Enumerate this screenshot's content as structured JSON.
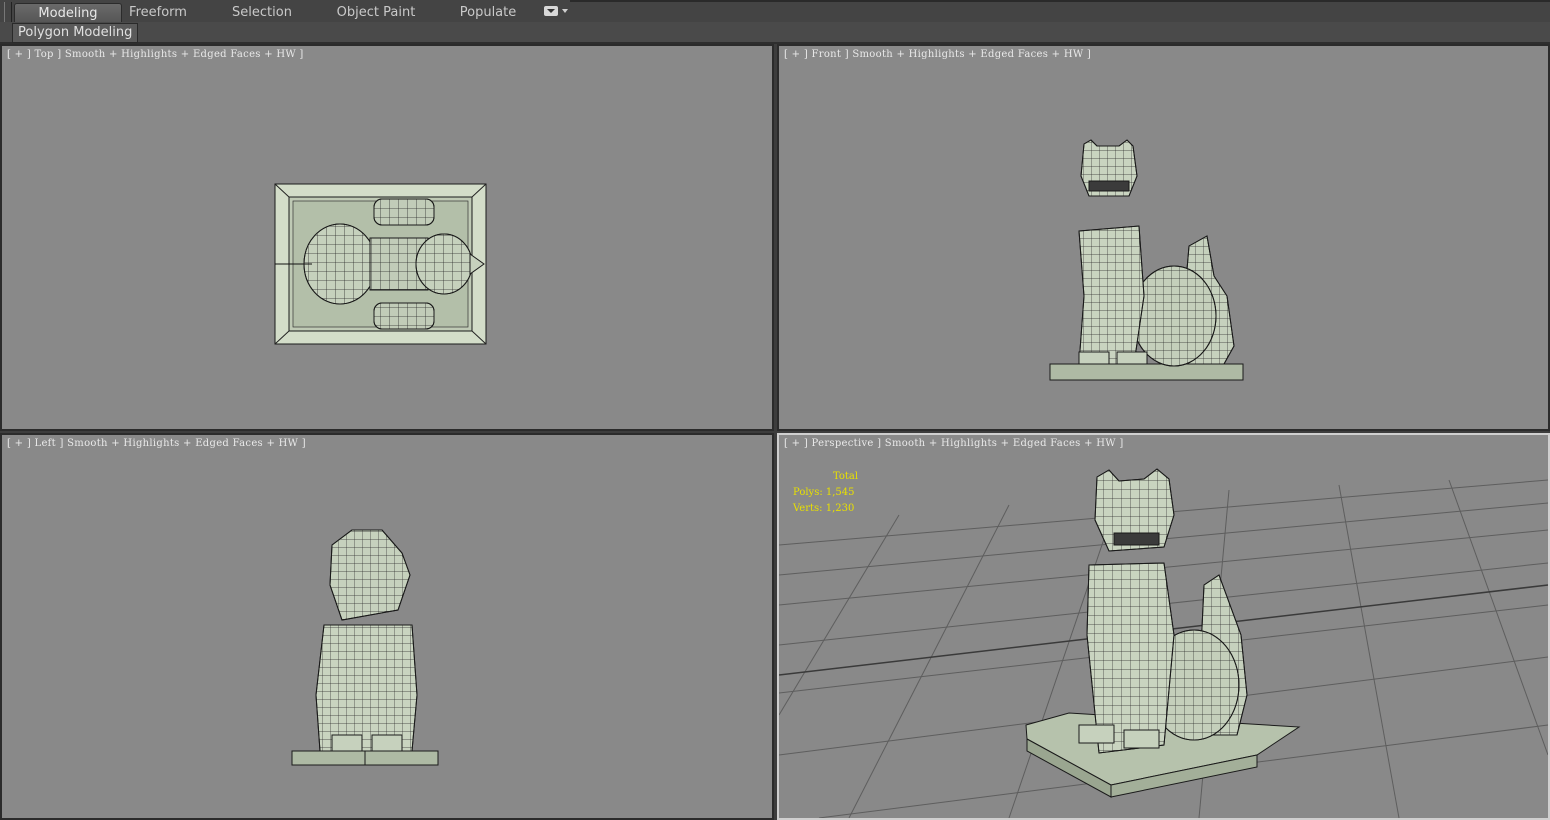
{
  "ribbon": {
    "tabs": [
      {
        "label": "Modeling",
        "active": true
      },
      {
        "label": "Freeform",
        "active": false
      },
      {
        "label": "Selection",
        "active": false
      },
      {
        "label": "Object Paint",
        "active": false
      },
      {
        "label": "Populate",
        "active": false
      }
    ],
    "panel_button": "Polygon Modeling"
  },
  "viewports": {
    "top": {
      "label": "[ + ] Top ] Smooth + Highlights + Edged Faces + HW ]"
    },
    "front": {
      "label": "[ + ] Front ] Smooth + Highlights + Edged Faces + HW ]"
    },
    "left": {
      "label": "[ + ] Left ] Smooth + Highlights + Edged Faces + HW ]"
    },
    "perspective": {
      "label": "[ + ] Perspective ] Smooth + Highlights + Edged Faces + HW ]",
      "stats": {
        "total": "Total",
        "polys": "Polys: 1,545",
        "verts": "Verts: 1,230"
      }
    }
  },
  "colors": {
    "viewport_bg": "#898989",
    "model_fill": "#c8d4c0",
    "wire": "#1a1a1a",
    "stats_text": "#e8e000",
    "active_border": "#cfcfcf"
  },
  "icons": [
    "ribbon-options-dropdown-icon"
  ]
}
